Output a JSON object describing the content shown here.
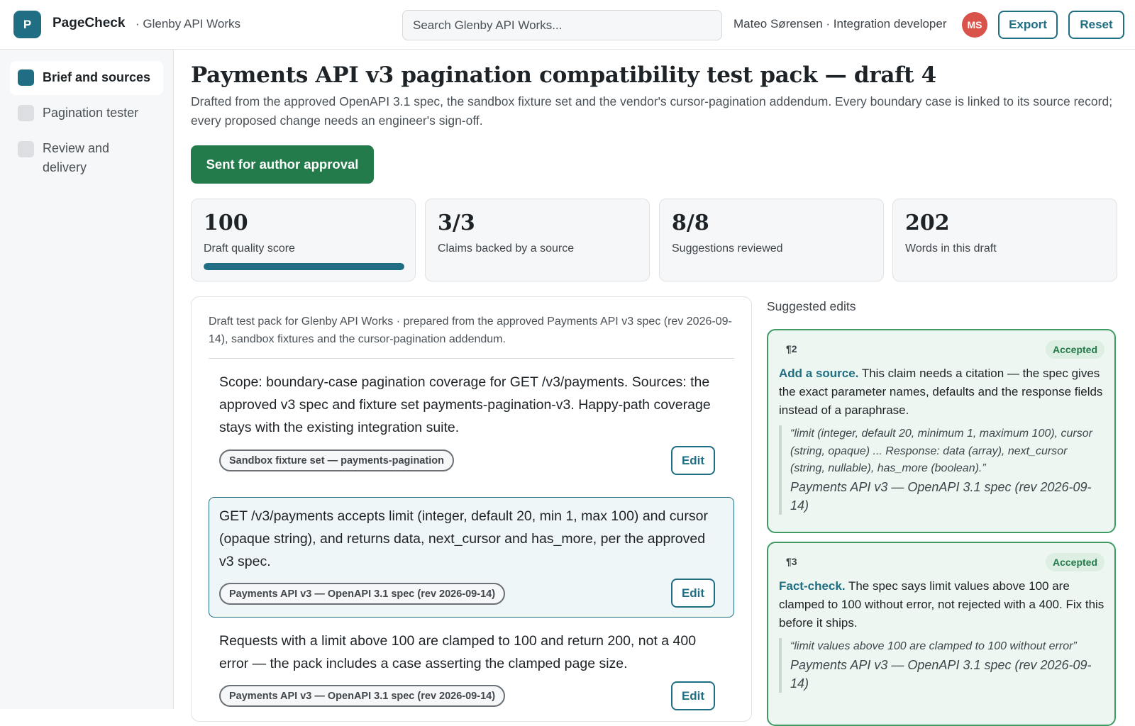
{
  "header": {
    "logo_letter": "P",
    "app_name": "PageCheck",
    "org": "· Glenby API Works",
    "search_placeholder": "Search Glenby API Works...",
    "user": "Mateo Sørensen · Integration developer",
    "avatar_initials": "MS",
    "export_label": "Export",
    "reset_label": "Reset"
  },
  "sidebar": {
    "items": [
      {
        "label": "Brief and sources",
        "active": true
      },
      {
        "label": "Pagination tester",
        "active": false
      },
      {
        "label": "Review and delivery",
        "active": false
      }
    ]
  },
  "main": {
    "title": "Payments API v3 pagination compatibility test pack — draft 4",
    "description": "Drafted from the approved OpenAPI 3.1 spec, the sandbox fixture set and the vendor's cursor-pagination addendum. Every boundary case is linked to its source record; every proposed change needs an engineer's sign-off.",
    "status_button": "Sent for author approval",
    "stats": [
      {
        "value": "100",
        "label": "Draft quality score",
        "progress": 1.0
      },
      {
        "value": "3/3",
        "label": "Claims backed by a source"
      },
      {
        "value": "8/8",
        "label": "Suggestions reviewed"
      },
      {
        "value": "202",
        "label": "Words in this draft"
      }
    ],
    "draft": {
      "header": "Draft test pack for Glenby API Works · prepared from the approved Payments API v3 spec (rev 2026-09-14), sandbox fixtures and the cursor-pagination addendum.",
      "paragraphs": [
        {
          "text": "Scope: boundary-case pagination coverage for GET /v3/payments. Sources: the approved v3 spec and fixture set payments-pagination-v3. Happy-path coverage stays with the existing integration suite.",
          "source": "Sandbox fixture set — payments-pagination",
          "edit": "Edit"
        },
        {
          "text": "GET /v3/payments accepts limit (integer, default 20, min 1, max 100) and cursor (opaque string), and returns data, next_cursor and has_more, per the approved v3 spec.",
          "source": "Payments API v3 — OpenAPI 3.1 spec (rev 2026-09-14)",
          "edit": "Edit"
        },
        {
          "text": "Requests with a limit above 100 are clamped to 100 and return 200, not a 400 error — the pack includes a case asserting the clamped page size.",
          "source": "Payments API v3 — OpenAPI 3.1 spec (rev 2026-09-14)",
          "edit": "Edit"
        }
      ]
    }
  },
  "suggestions": {
    "title": "Suggested edits",
    "items": [
      {
        "para": "¶2",
        "status": "Accepted",
        "action": "Add a source.",
        "body": " This claim needs a citation — the spec gives the exact parameter names, defaults and the response fields instead of a paraphrase.",
        "quote": "“limit (integer, default 20, minimum 1, maximum 100), cursor (string, opaque) ... Response: data (array), next_cursor (string, nullable), has_more (boolean).”",
        "source": "Payments API v3 — OpenAPI 3.1 spec (rev 2026-09-14)"
      },
      {
        "para": "¶3",
        "status": "Accepted",
        "action": "Fact-check.",
        "body": " The spec says limit values above 100 are clamped to 100 without error, not rejected with a 400. Fix this before it ships.",
        "quote": "“limit values above 100 are clamped to 100 without error”",
        "source": "Payments API v3 — OpenAPI 3.1 spec (rev 2026-09-14)"
      }
    ]
  },
  "colors": {
    "accent": "#1f6e83",
    "success": "#237a4a",
    "avatar": "#d9534a"
  }
}
